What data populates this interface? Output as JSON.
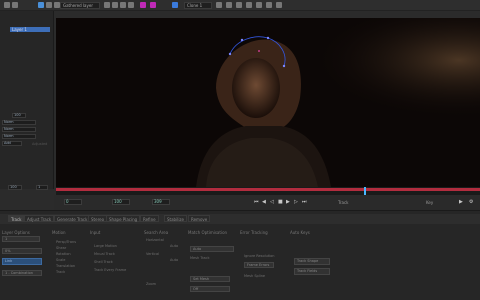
{
  "toolbar": {
    "layer_select": "Gathered layer",
    "view_select": "Clone 1",
    "tools": [
      "select-arrow-icon",
      "move-icon",
      "pointer-icon",
      "magnifier-icon",
      "hand-icon",
      "circle-icon",
      "bezier-icon",
      "xspline-icon",
      "link-icon",
      "crosshair-icon",
      "plus-icon",
      "pen-icon",
      "lasso-icon",
      "track-icon",
      "stop-icon",
      "grid-icon",
      "mask-icon",
      "eye-icon",
      "dot-icon",
      "dot-icon-2",
      "settings-icon",
      "target-icon",
      "transform-icon",
      "wave-icon"
    ]
  },
  "left_panel": {
    "layers": [
      "Layer 1"
    ],
    "fields": [
      "100",
      "Norm",
      "Norm",
      "Norm",
      "Add",
      "1"
    ],
    "misc": [
      "100",
      "Adjusted",
      "100",
      "0"
    ]
  },
  "controls": {
    "frame_start": "0",
    "current_frame": "100",
    "frame_end": "309",
    "right_value": "100",
    "labels": [
      "Track",
      "Key"
    ]
  },
  "tabs": [
    "Track",
    "Adjust Track",
    "Generate Track",
    "Stereo",
    "Shape Placing",
    "Refine",
    "Stabilize",
    "Remove"
  ],
  "sections": {
    "layer_column": {
      "title": "Layer Options",
      "opts": [
        "1",
        "0%",
        "Link",
        "1 - Combination"
      ]
    },
    "motion": {
      "title": "Motion",
      "opts": [
        "Persp/Trans",
        "Shear",
        "Rotation",
        "Scale",
        "Translation",
        "Track"
      ]
    },
    "input": {
      "title": "Input",
      "opts": [
        "Large Motion",
        "Mnual Track",
        "Shell Track",
        "Track Every Frame"
      ]
    },
    "search_area": {
      "title": "Search Area",
      "opts": [
        "Horizontal",
        "Vertical",
        "Auto",
        "Auto",
        "Zoom"
      ]
    },
    "match": {
      "title": "Match Optimisation",
      "opts": [
        "Auto",
        "Mesh Track",
        "Set Mesh",
        "Off"
      ]
    },
    "tracking": {
      "title": "Error Tracking",
      "opts": [
        "Ignore Resolution",
        "Frame Errors",
        "Mesh Spline"
      ]
    },
    "auto_keys": {
      "title": "Auto Keys",
      "buttons": [
        "Track Shape",
        "Track Fields"
      ]
    }
  }
}
